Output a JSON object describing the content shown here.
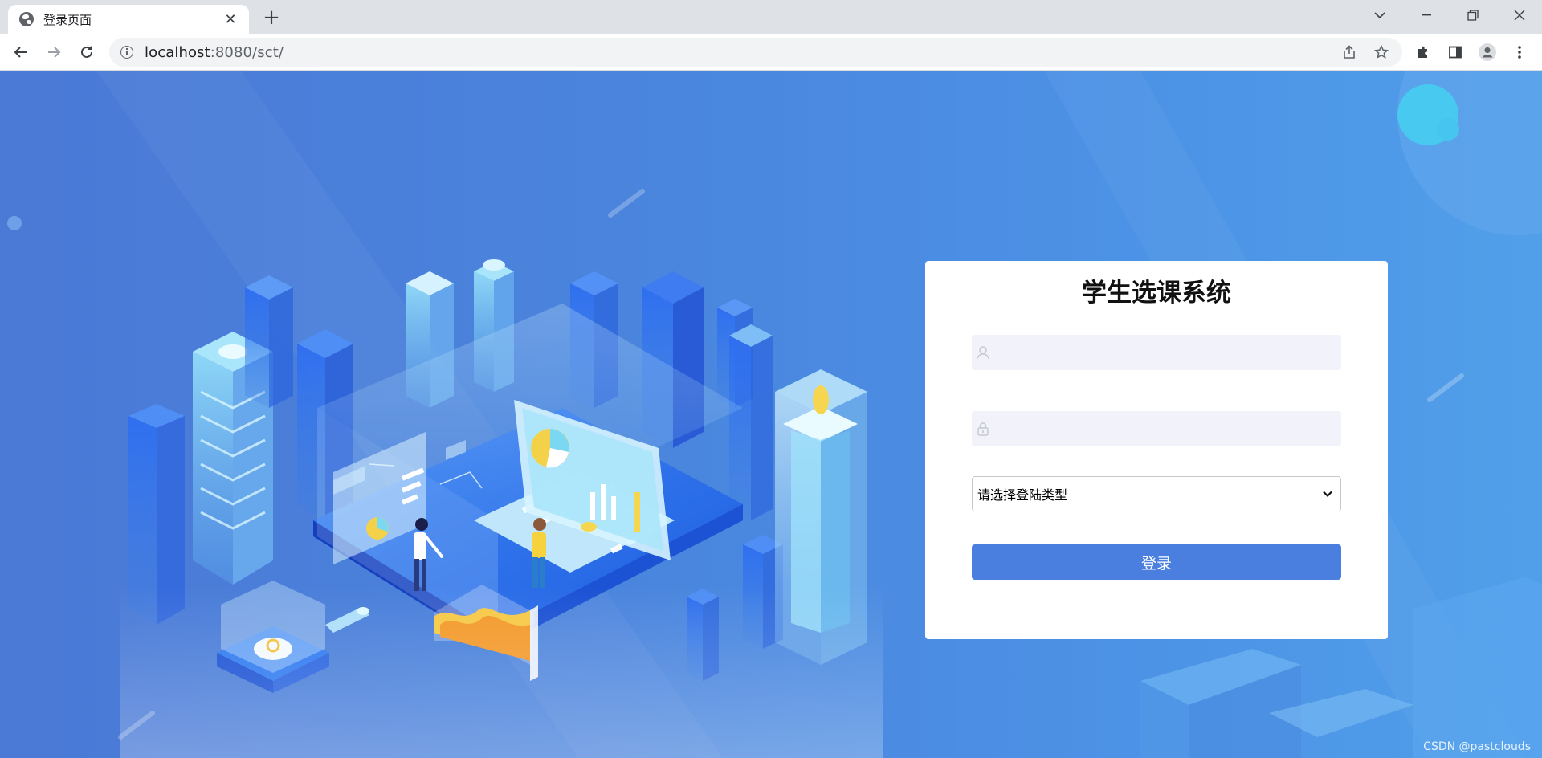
{
  "browser": {
    "tab": {
      "title": "登录页面",
      "favicon": "globe-icon"
    },
    "url_host": "localhost",
    "url_rest": ":8080/sct/",
    "controls": [
      "minimize-icon",
      "restore-icon",
      "close-icon"
    ]
  },
  "login": {
    "title": "学生选课系统",
    "username_placeholder": "",
    "password_placeholder": "",
    "select_value": "请选择登陆类型",
    "button_label": "登录"
  },
  "watermark": "CSDN @pastclouds"
}
